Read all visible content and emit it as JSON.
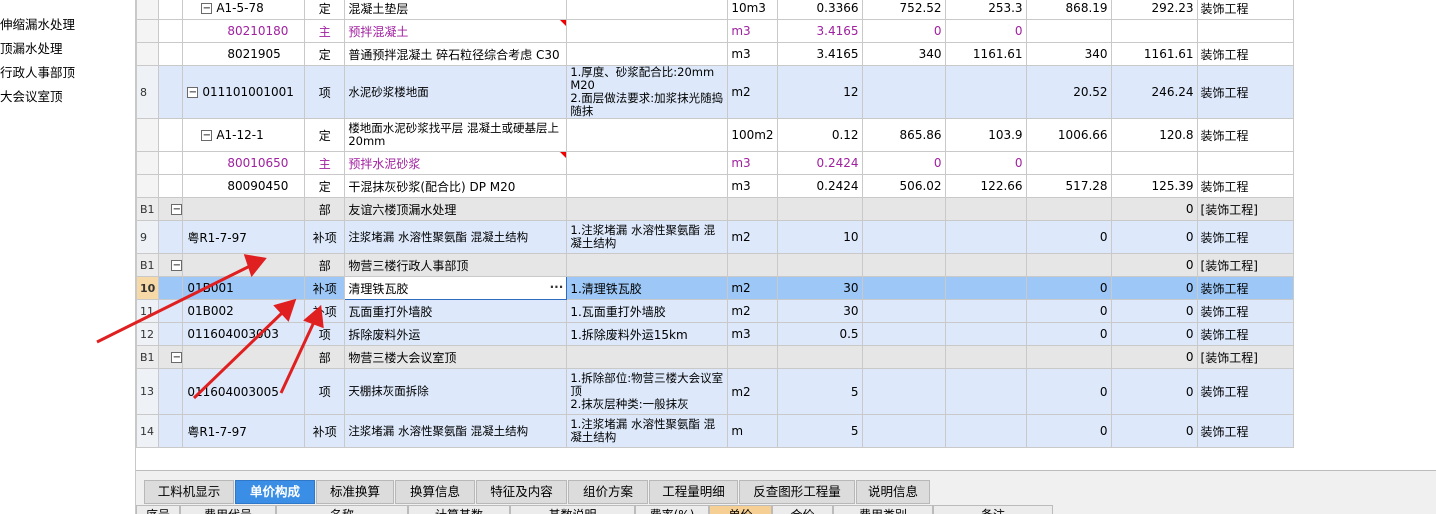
{
  "tree": {
    "items": [
      "伸缩漏水处理",
      "顶漏水处理",
      "行政人事部顶",
      "大会议室顶"
    ]
  },
  "rows": [
    {
      "sn": "",
      "code": "A1-5-78",
      "level": 1,
      "exp": "−",
      "type": "定",
      "name": "混凝土垫层",
      "feature": "",
      "unit": "10m3",
      "qty": "0.3366",
      "p1": "752.52",
      "p2": "253.3",
      "p3": "868.19",
      "p4": "292.23",
      "cat": "装饰工程",
      "style": "white"
    },
    {
      "sn": "",
      "code": "80210180",
      "level": 2,
      "type": "主",
      "name": "预拌混凝土",
      "feature": "",
      "unit": "m3",
      "qty": "3.4165",
      "p1": "0",
      "p2": "0",
      "p3": "",
      "p4": "",
      "cat": "",
      "style": "white",
      "purple": true
    },
    {
      "sn": "",
      "code": "8021905",
      "level": 2,
      "type": "定",
      "name": "普通预拌混凝土 碎石粒径综合考虑 C30",
      "feature": "",
      "unit": "m3",
      "qty": "3.4165",
      "p1": "340",
      "p2": "1161.61",
      "p3": "340",
      "p4": "1161.61",
      "cat": "装饰工程",
      "style": "white"
    },
    {
      "sn": "8",
      "code": "011101001001",
      "level": 0,
      "exp": "−",
      "type": "项",
      "name": "水泥砂浆楼地面",
      "feature": "1.厚度、砂浆配合比:20mm M20\n2.面层做法要求:加浆抹光随捣随抹",
      "unit": "m2",
      "qty": "12",
      "p1": "",
      "p2": "",
      "p3": "20.52",
      "p4": "246.24",
      "cat": "装饰工程",
      "style": "blue",
      "tall": true
    },
    {
      "sn": "",
      "code": "A1-12-1",
      "level": 1,
      "exp": "−",
      "type": "定",
      "name": "楼地面水泥砂浆找平层 混凝土或硬基层上 20mm",
      "feature": "",
      "unit": "100m2",
      "qty": "0.12",
      "p1": "865.86",
      "p2": "103.9",
      "p3": "1006.66",
      "p4": "120.8",
      "cat": "装饰工程",
      "style": "white",
      "mid": true
    },
    {
      "sn": "",
      "code": "80010650",
      "level": 2,
      "type": "主",
      "name": "预拌水泥砂浆",
      "feature": "",
      "unit": "m3",
      "qty": "0.2424",
      "p1": "0",
      "p2": "0",
      "p3": "",
      "p4": "",
      "cat": "",
      "style": "white",
      "purple": true
    },
    {
      "sn": "",
      "code": "80090450",
      "level": 2,
      "type": "定",
      "name": "干混抹灰砂浆(配合比) DP M20",
      "feature": "",
      "unit": "m3",
      "qty": "0.2424",
      "p1": "506.02",
      "p2": "122.66",
      "p3": "517.28",
      "p4": "125.39",
      "cat": "装饰工程",
      "style": "white"
    },
    {
      "sn": "B1",
      "code": "",
      "level": -1,
      "exp": "−",
      "type": "部",
      "name": "友谊六楼顶漏水处理",
      "feature": "",
      "unit": "",
      "qty": "",
      "p1": "",
      "p2": "",
      "p3": "",
      "p4": "0",
      "cat": "[装饰工程]",
      "style": "gray"
    },
    {
      "sn": "9",
      "code": "粤R1-7-97",
      "level": 0,
      "type": "补项",
      "name": "注浆堵漏 水溶性聚氨酯 混凝土结构",
      "feature": "1.注浆堵漏 水溶性聚氨酯 混凝土结构",
      "unit": "m2",
      "qty": "10",
      "p1": "",
      "p2": "",
      "p3": "0",
      "p4": "0",
      "cat": "装饰工程",
      "style": "blue",
      "mid": true
    },
    {
      "sn": "B1",
      "code": "",
      "level": -1,
      "exp": "−",
      "type": "部",
      "name": "物营三楼行政人事部顶",
      "feature": "",
      "unit": "",
      "qty": "",
      "p1": "",
      "p2": "",
      "p3": "",
      "p4": "0",
      "cat": "[装饰工程]",
      "style": "gray"
    },
    {
      "sn": "10",
      "code": "01B001",
      "level": 0,
      "type": "补项",
      "name": "清理铁瓦胶",
      "feature": "1.清理铁瓦胶",
      "unit": "m2",
      "qty": "30",
      "p1": "",
      "p2": "",
      "p3": "0",
      "p4": "0",
      "cat": "装饰工程",
      "style": "sel",
      "edit": true
    },
    {
      "sn": "11",
      "code": "01B002",
      "level": 0,
      "type": "补项",
      "name": "瓦面重打外墙胶",
      "feature": "1.瓦面重打外墙胶",
      "unit": "m2",
      "qty": "30",
      "p1": "",
      "p2": "",
      "p3": "0",
      "p4": "0",
      "cat": "装饰工程",
      "style": "blue"
    },
    {
      "sn": "12",
      "code": "011604003003",
      "level": 0,
      "type": "项",
      "name": "拆除废料外运",
      "feature": "1.拆除废料外运15km",
      "unit": "m3",
      "qty": "0.5",
      "p1": "",
      "p2": "",
      "p3": "0",
      "p4": "0",
      "cat": "装饰工程",
      "style": "blue"
    },
    {
      "sn": "B1",
      "code": "",
      "level": -1,
      "exp": "−",
      "type": "部",
      "name": "物营三楼大会议室顶",
      "feature": "",
      "unit": "",
      "qty": "",
      "p1": "",
      "p2": "",
      "p3": "",
      "p4": "0",
      "cat": "[装饰工程]",
      "style": "gray"
    },
    {
      "sn": "13",
      "code": "011604003005",
      "level": 0,
      "type": "项",
      "name": "天棚抹灰面拆除",
      "feature": "1.拆除部位:物营三楼大会议室顶\n2.抹灰层种类:一般抹灰",
      "unit": "m2",
      "qty": "5",
      "p1": "",
      "p2": "",
      "p3": "0",
      "p4": "0",
      "cat": "装饰工程",
      "style": "blue",
      "tall": true
    },
    {
      "sn": "14",
      "code": "粤R1-7-97",
      "level": 0,
      "type": "补项",
      "name": "注浆堵漏 水溶性聚氨酯 混凝土结构",
      "feature": "1.注浆堵漏 水溶性聚氨酯 混凝土结构",
      "unit": "m",
      "qty": "5",
      "p1": "",
      "p2": "",
      "p3": "0",
      "p4": "0",
      "cat": "装饰工程",
      "style": "blue",
      "mid": true
    }
  ],
  "tabs": [
    "工料机显示",
    "单价构成",
    "标准换算",
    "换算信息",
    "特征及内容",
    "组价方案",
    "工程量明细",
    "反查图形工程量",
    "说明信息"
  ],
  "active_tab": "单价构成",
  "subheader": [
    "序号",
    "费用代号",
    "名称",
    "计算基数",
    "基数说明",
    "费率(%)",
    "单价",
    "合价",
    "费用类别",
    "备注"
  ],
  "colors": {
    "accent": "#3a8ee6",
    "row_blue": "#dde9fb",
    "row_selected": "#9cc7f6",
    "arrow": "#e02020",
    "purple": "#a020a0"
  }
}
